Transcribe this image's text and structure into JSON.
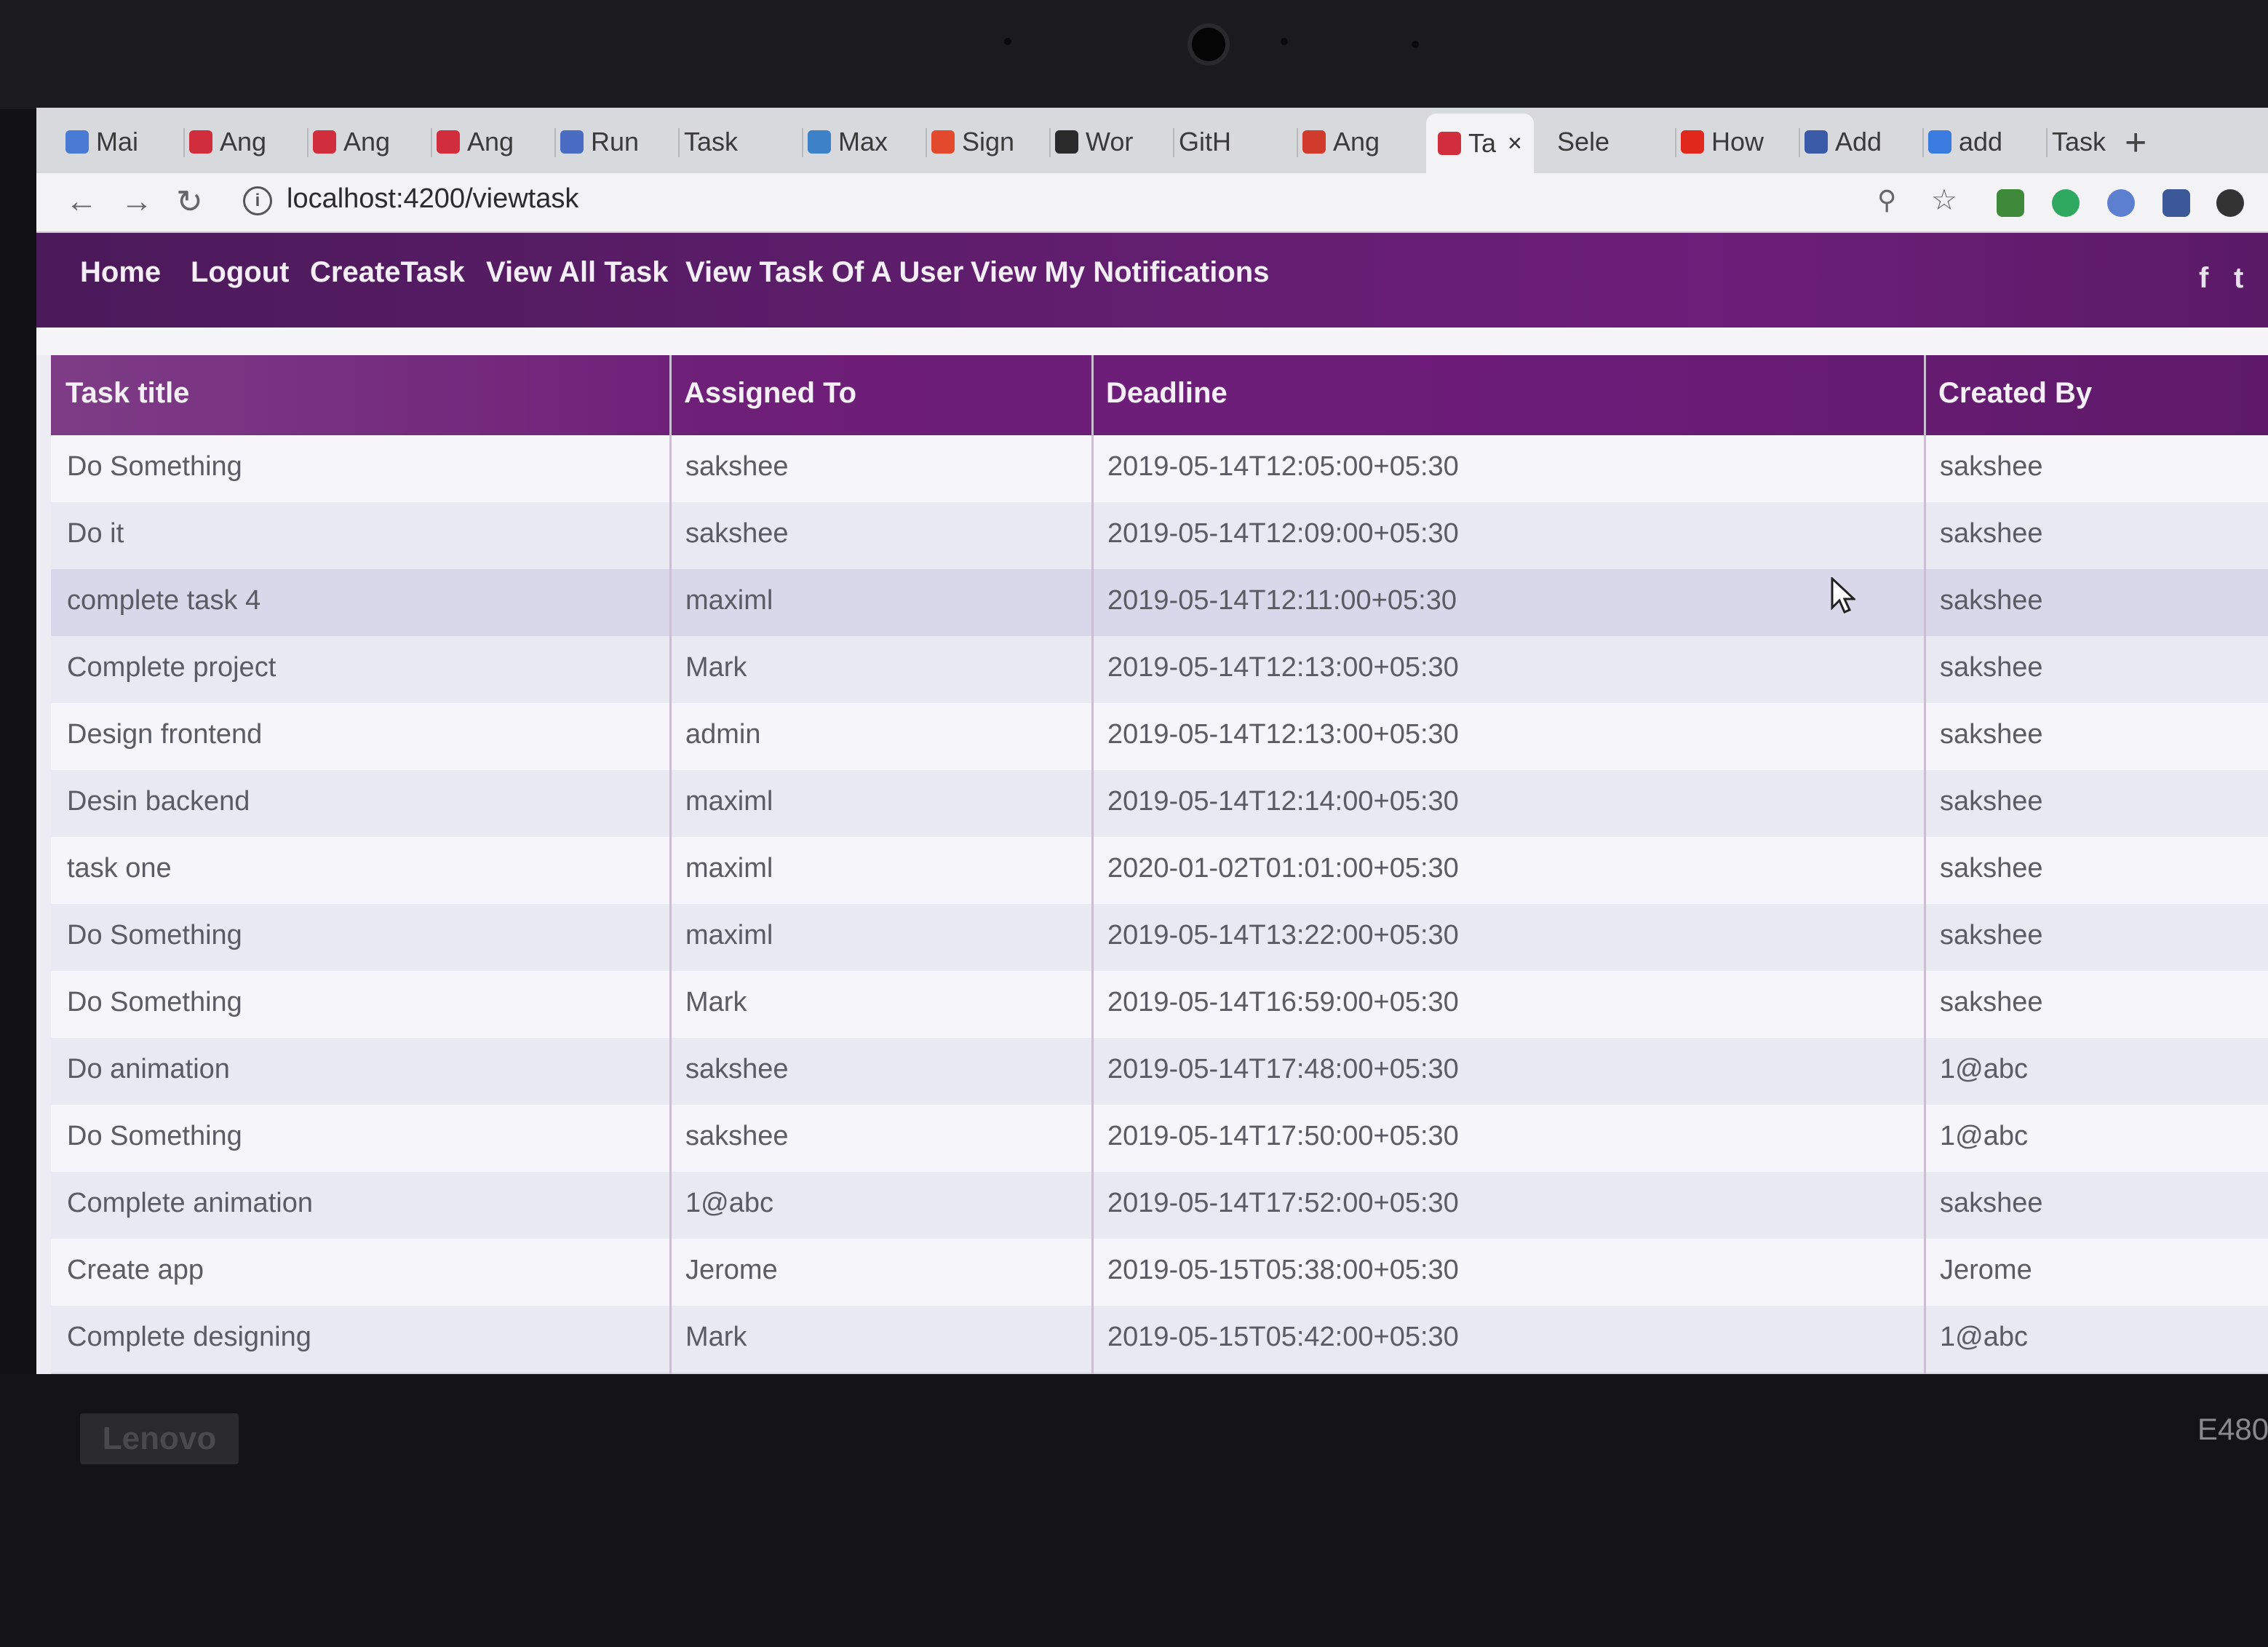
{
  "browser": {
    "tabs": [
      {
        "label": "Mai",
        "icon": "gmail-icon",
        "color": "#4a7bd4"
      },
      {
        "label": "Ang",
        "icon": "angular-icon",
        "color": "#d12e3d"
      },
      {
        "label": "Ang",
        "icon": "angular-icon",
        "color": "#d12e3d"
      },
      {
        "label": "Ang",
        "icon": "angular-icon",
        "color": "#d12e3d"
      },
      {
        "label": "Run",
        "icon": "document-icon",
        "color": "#4a6cc2"
      },
      {
        "label": "Task",
        "icon": "",
        "color": "#d8d9dd"
      },
      {
        "label": "Max",
        "icon": "stackblitz-icon",
        "color": "#3d82c9"
      },
      {
        "label": "Sign",
        "icon": "gitlab-icon",
        "color": "#e2492d"
      },
      {
        "label": "Wor",
        "icon": "wordpress-icon",
        "color": "#2a2a2a"
      },
      {
        "label": "GitH",
        "icon": "",
        "color": "#d8d9dd"
      },
      {
        "label": "Ang",
        "icon": "angular-icon",
        "color": "#d13b2b"
      },
      {
        "label": "Ta",
        "icon": "angular-icon",
        "color": "#d12e3d",
        "active": true
      },
      {
        "label": "Sele",
        "icon": "",
        "color": "#d8d9dd"
      },
      {
        "label": "How",
        "icon": "youtube-icon",
        "color": "#e0281d"
      },
      {
        "label": "Add",
        "icon": "extension-icon",
        "color": "#3b5aa8"
      },
      {
        "label": "add",
        "icon": "google-icon",
        "color": "#3a7be0"
      },
      {
        "label": "Task",
        "icon": "",
        "color": "#d8d9dd"
      }
    ],
    "url": "localhost:4200/viewtask"
  },
  "nav": {
    "links": [
      "Home",
      "Logout",
      "CreateTask",
      "View All Task",
      "View Task Of A User",
      "View My Notifications"
    ],
    "social": [
      "f",
      "t"
    ]
  },
  "table": {
    "headers": [
      "Task title",
      "Assigned To",
      "Deadline",
      "Created By"
    ],
    "rows": [
      [
        "Do Something",
        "sakshee",
        "2019-05-14T12:05:00+05:30",
        "sakshee"
      ],
      [
        "Do it",
        "sakshee",
        "2019-05-14T12:09:00+05:30",
        "sakshee"
      ],
      [
        "complete task 4",
        "maximl",
        "2019-05-14T12:11:00+05:30",
        "sakshee"
      ],
      [
        "Complete project",
        "Mark",
        "2019-05-14T12:13:00+05:30",
        "sakshee"
      ],
      [
        "Design frontend",
        "admin",
        "2019-05-14T12:13:00+05:30",
        "sakshee"
      ],
      [
        "Desin backend",
        "maximl",
        "2019-05-14T12:14:00+05:30",
        "sakshee"
      ],
      [
        "task one",
        "maximl",
        "2020-01-02T01:01:00+05:30",
        "sakshee"
      ],
      [
        "Do Something",
        "maximl",
        "2019-05-14T13:22:00+05:30",
        "sakshee"
      ],
      [
        "Do Something",
        "Mark",
        "2019-05-14T16:59:00+05:30",
        "sakshee"
      ],
      [
        "Do animation",
        "sakshee",
        "2019-05-14T17:48:00+05:30",
        "1@abc"
      ],
      [
        "Do Something",
        "sakshee",
        "2019-05-14T17:50:00+05:30",
        "1@abc"
      ],
      [
        "Complete animation",
        "1@abc",
        "2019-05-14T17:52:00+05:30",
        "sakshee"
      ],
      [
        "Create app",
        "Jerome",
        "2019-05-15T05:38:00+05:30",
        "Jerome"
      ],
      [
        "Complete designing",
        "Mark",
        "2019-05-15T05:42:00+05:30",
        "1@abc"
      ]
    ]
  },
  "device": {
    "brand": "Lenovo",
    "model": "E480"
  },
  "colors": {
    "header_purple": "#6b1c78",
    "nav_purple": "#5e1d6b"
  }
}
